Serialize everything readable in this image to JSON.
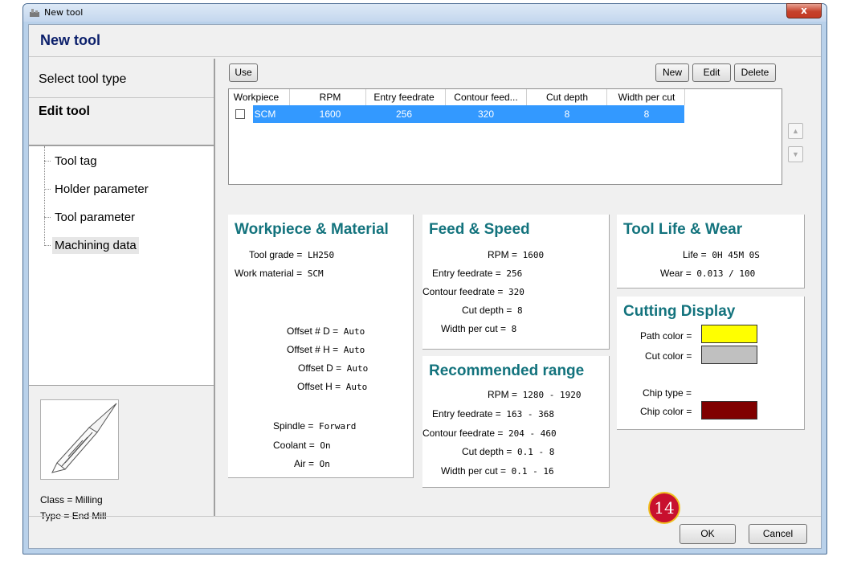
{
  "window": {
    "title": "New tool",
    "close_label": "x"
  },
  "header": {
    "title": "New tool"
  },
  "steps": [
    {
      "label": "Select tool type"
    },
    {
      "label": "Edit tool"
    }
  ],
  "tree": {
    "items": [
      {
        "label": "Tool tag"
      },
      {
        "label": "Holder parameter"
      },
      {
        "label": "Tool parameter"
      },
      {
        "label": "Machining data"
      }
    ]
  },
  "tool_info": {
    "class_label": "Class = Milling",
    "type_label": "Type = End Mill"
  },
  "toolbar": {
    "use_label": "Use",
    "new_label": "New",
    "edit_label": "Edit",
    "delete_label": "Delete"
  },
  "grid": {
    "headers": [
      "Workpiece",
      "RPM",
      "Entry feedrate",
      "Contour feed...",
      "Cut depth",
      "Width per cut"
    ],
    "rows": [
      {
        "checked": false,
        "cells": [
          "SCM",
          "1600",
          "256",
          "320",
          "8",
          "8"
        ]
      }
    ]
  },
  "workpiece": {
    "title": "Workpiece & Material",
    "tool_grade_k": "Tool grade =",
    "tool_grade_v": "LH250",
    "work_material_k": "Work material =",
    "work_material_v": "SCM",
    "offset_d_num_k": "Offset # D =",
    "offset_d_num_v": "Auto",
    "offset_h_num_k": "Offset # H =",
    "offset_h_num_v": "Auto",
    "offset_d_k": "Offset D =",
    "offset_d_v": "Auto",
    "offset_h_k": "Offset H =",
    "offset_h_v": "Auto",
    "spindle_k": "Spindle =",
    "spindle_v": "Forward",
    "coolant_k": "Coolant =",
    "coolant_v": "On",
    "air_k": "Air =",
    "air_v": "On"
  },
  "feed_speed": {
    "title": "Feed & Speed",
    "rpm_k": "RPM =",
    "rpm_v": "1600",
    "entry_k": "Entry feedrate =",
    "entry_v": "256",
    "contour_k": "Contour feedrate =",
    "contour_v": "320",
    "cut_depth_k": "Cut depth =",
    "cut_depth_v": "8",
    "width_k": "Width per cut =",
    "width_v": "8"
  },
  "recommended": {
    "title": "Recommended range",
    "rpm_k": "RPM =",
    "rpm_v": "1280 - 1920",
    "entry_k": "Entry feedrate =",
    "entry_v": "163 - 368",
    "contour_k": "Contour feedrate =",
    "contour_v": "204 - 460",
    "cut_depth_k": "Cut depth =",
    "cut_depth_v": "0.1 - 8",
    "width_k": "Width per cut =",
    "width_v": "0.1 - 16"
  },
  "tool_life": {
    "title": "Tool Life & Wear",
    "life_k": "Life =",
    "life_v": "0H 45M 0S",
    "wear_k": "Wear =",
    "wear_v": "0.013 / 100"
  },
  "cutting_display": {
    "title": "Cutting Display",
    "path_color_k": "Path color =",
    "path_color": "#ffff00",
    "cut_color_k": "Cut color =",
    "cut_color": "#c0c0c0",
    "chip_type_k": "Chip type =",
    "chip_type_v": "",
    "chip_color_k": "Chip color =",
    "chip_color": "#800000"
  },
  "footer": {
    "ok_label": "OK",
    "cancel_label": "Cancel"
  },
  "badge": {
    "number": "14"
  },
  "colors": {
    "accent_title": "#13737d",
    "header_title": "#0b1f6b",
    "selection": "#3399ff"
  }
}
